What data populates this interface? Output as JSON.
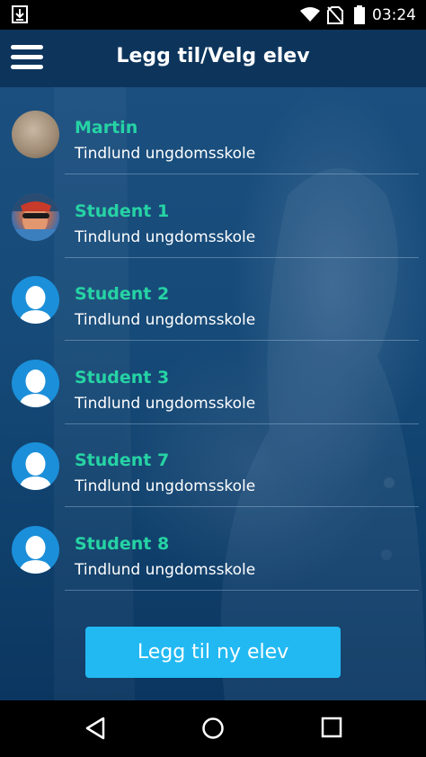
{
  "status_bar": {
    "time": "03:24",
    "icons": [
      "download-icon",
      "wifi-icon",
      "no-sim-icon",
      "battery-icon"
    ]
  },
  "app_bar": {
    "title": "Legg til/Velg elev",
    "menu_icon": "hamburger-menu-icon"
  },
  "students": [
    {
      "name": "Martin",
      "school": "Tindlund ungdomsskole",
      "avatar": "photo"
    },
    {
      "name": "Student 1",
      "school": "Tindlund ungdomsskole",
      "avatar": "photo"
    },
    {
      "name": "Student 2",
      "school": "Tindlund ungdomsskole",
      "avatar": "placeholder"
    },
    {
      "name": "Student 3",
      "school": "Tindlund ungdomsskole",
      "avatar": "placeholder"
    },
    {
      "name": "Student 7",
      "school": "Tindlund ungdomsskole",
      "avatar": "placeholder"
    },
    {
      "name": "Student 8",
      "school": "Tindlund ungdomsskole",
      "avatar": "placeholder"
    }
  ],
  "add_button": {
    "label": "Legg til ny elev"
  },
  "nav_bar": {
    "icons": [
      "back-icon",
      "home-icon",
      "recents-icon"
    ]
  },
  "colors": {
    "accent_green": "#26d3a4",
    "button_blue": "#22b9f2",
    "app_bar": "#0d355c",
    "avatar_placeholder": "#1b8fd9"
  }
}
